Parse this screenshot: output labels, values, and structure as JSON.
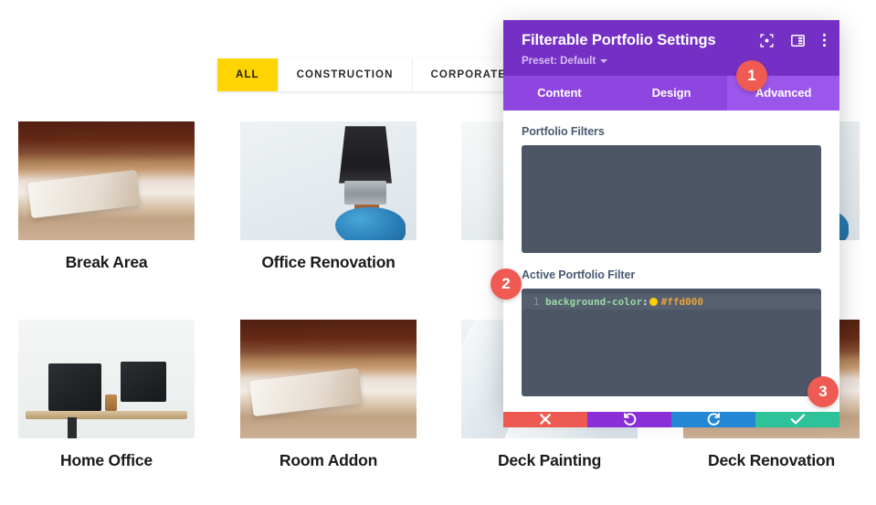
{
  "portfolio": {
    "filters": [
      {
        "label": "ALL",
        "active": true
      },
      {
        "label": "CONSTRUCTION",
        "active": false
      },
      {
        "label": "CORPORATE",
        "active": false
      }
    ],
    "items": [
      {
        "title": "Break Area"
      },
      {
        "title": "Office Renovation"
      },
      {
        "title": "Home Office"
      },
      {
        "title": "Room Addon"
      },
      {
        "title": "Deck Painting"
      },
      {
        "title": "Deck Renovation"
      }
    ]
  },
  "panel": {
    "title": "Filterable Portfolio Settings",
    "preset_label": "Preset: Default",
    "header_icons": [
      {
        "name": "focus-target-icon"
      },
      {
        "name": "layout-panel-icon"
      },
      {
        "name": "more-vertical-icon"
      }
    ],
    "tabs": [
      {
        "label": "Content",
        "active": false
      },
      {
        "label": "Design",
        "active": false
      },
      {
        "label": "Advanced",
        "active": true
      }
    ],
    "fields": [
      {
        "label": "Portfolio Filters",
        "value": ""
      },
      {
        "label": "Active Portfolio Filter",
        "value": "background-color: #ffd000"
      }
    ],
    "code": {
      "line_number": "1",
      "property": "background-color",
      "punctuation": ":",
      "value": "#ffd000",
      "swatch_color": "#ffd000"
    },
    "actions": [
      {
        "name": "cancel-button",
        "icon": "close-icon",
        "color": "#ec5a52"
      },
      {
        "name": "undo-button",
        "icon": "undo-icon",
        "color": "#8a2ed8"
      },
      {
        "name": "redo-button",
        "icon": "redo-icon",
        "color": "#2387d6"
      },
      {
        "name": "save-button",
        "icon": "check-icon",
        "color": "#2ec29a"
      }
    ]
  },
  "badges": [
    {
      "number": "1"
    },
    {
      "number": "2"
    },
    {
      "number": "3"
    }
  ],
  "colors": {
    "accent_yellow": "#ffd400",
    "panel_header_purple": "#7430c4",
    "tabbar_purple": "#8f46e0",
    "active_tab_purple": "#9b56ec",
    "badge_red": "#ef5a52",
    "code_bg": "#4c5666"
  }
}
